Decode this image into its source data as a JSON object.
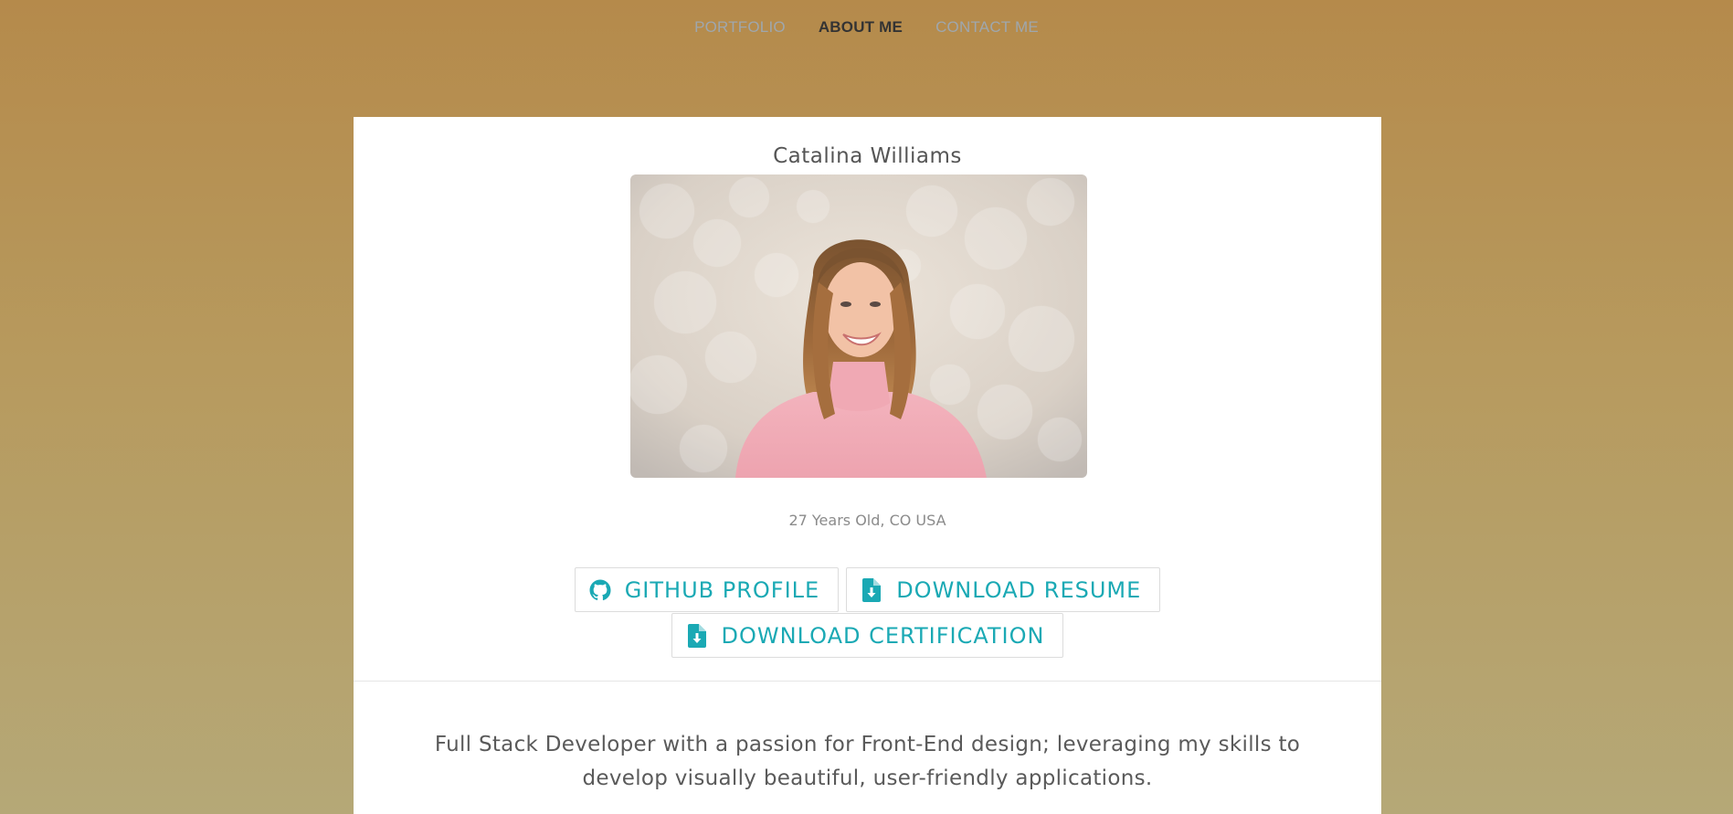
{
  "nav": {
    "items": [
      {
        "label": "PORTFOLIO"
      },
      {
        "label": "ABOUT ME"
      },
      {
        "label": "CONTACT ME"
      }
    ]
  },
  "profile": {
    "name": "Catalina Williams",
    "photo_alt": "Portrait photo",
    "meta": "27 Years Old, CO USA"
  },
  "buttons": {
    "github": "GITHUB PROFILE",
    "resume": "DOWNLOAD RESUME",
    "certification": "DOWNLOAD CERTIFICATION"
  },
  "bio": {
    "text": "Full Stack Developer with a passion for Front-End design; leveraging my skills to develop visually beautiful, user-friendly applications."
  },
  "colors": {
    "accent": "#1aa9b4",
    "nav_active": "#333333",
    "nav_muted": "#9fa7ad"
  }
}
